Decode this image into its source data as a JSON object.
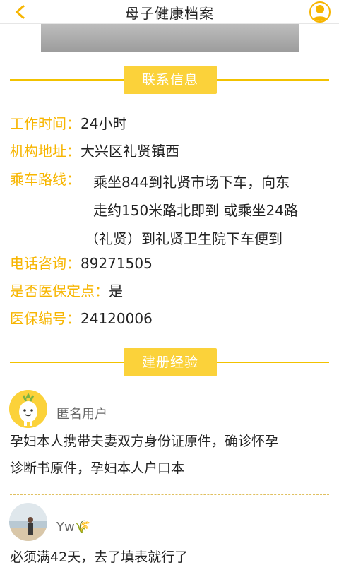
{
  "header": {
    "title": "母子健康档案",
    "back_icon": "chevron-left-icon",
    "user_icon": "user-icon"
  },
  "sections": {
    "contact": "联系信息",
    "experience": "建册经验"
  },
  "info": {
    "work_hours_label": "工作时间：",
    "work_hours_value": "24小时",
    "address_label": "机构地址：",
    "address_value": "大兴区礼贤镇西",
    "route_label": "乘车路线：",
    "route_line1": "乘坐844到礼贤市场下车，向东",
    "route_line2": "走约150米路北即到 或乘坐24路",
    "route_line3": "（礼贤）到礼贤卫生院下车便到",
    "phone_label": "电话咨询：",
    "phone_value": "89271505",
    "insurance_label": "是否医保定点：",
    "insurance_value": "是",
    "insurance_no_label": "医保编号：",
    "insurance_no_value": "24120006"
  },
  "reviews": [
    {
      "name": "匿名用户",
      "text_line1": "孕妇本人携带夫妻双方身份证原件，确诊怀孕",
      "text_line2": "诊断书原件，孕妇本人户口本"
    },
    {
      "name": "Yw🌾",
      "text_line1": "必须满42天，去了填表就行了"
    }
  ],
  "colors": {
    "accent": "#f7b500",
    "pill": "#fbd23a",
    "line": "#f2c200"
  }
}
